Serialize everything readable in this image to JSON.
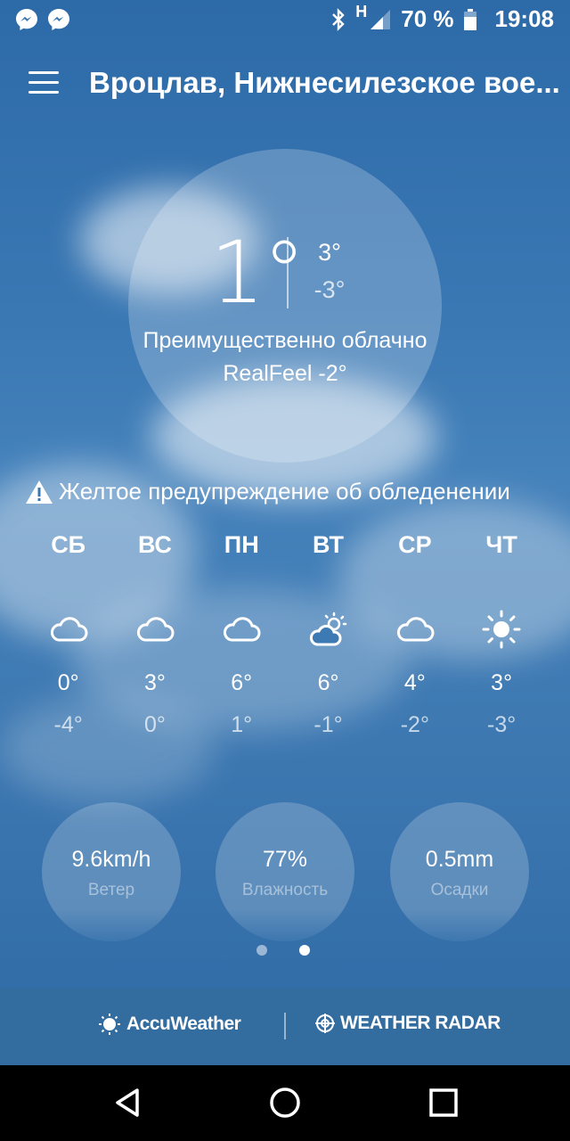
{
  "status_bar": {
    "icons_left": [
      "messenger-icon",
      "messenger-icon"
    ],
    "network": "H",
    "battery": "70 %",
    "time": "19:08"
  },
  "header": {
    "location": "Вроцлав, Нижнесилезское вое..."
  },
  "current": {
    "temp": "1°",
    "high": "3°",
    "low": "-3°",
    "condition": "Преимущественно облачно",
    "realfeel": "RealFeel -2°"
  },
  "alert": {
    "text": "Желтое предупреждение об обледенении"
  },
  "forecast": [
    {
      "day": "СБ",
      "icon": "cloud-icon",
      "high": "0°",
      "low": "-4°"
    },
    {
      "day": "ВС",
      "icon": "cloud-icon",
      "high": "3°",
      "low": "0°"
    },
    {
      "day": "ПН",
      "icon": "cloud-icon",
      "high": "6°",
      "low": "1°"
    },
    {
      "day": "ВТ",
      "icon": "partly-sunny-icon",
      "high": "6°",
      "low": "-1°"
    },
    {
      "day": "СР",
      "icon": "cloud-icon",
      "high": "4°",
      "low": "-2°"
    },
    {
      "day": "ЧТ",
      "icon": "sun-icon",
      "high": "3°",
      "low": "-3°"
    }
  ],
  "metrics": [
    {
      "value": "9.6km/h",
      "label": "Ветер"
    },
    {
      "value": "77%",
      "label": "Влажность"
    },
    {
      "value": "0.5mm",
      "label": "Осадки"
    }
  ],
  "pager": {
    "pages": 2,
    "active": 2
  },
  "footer": {
    "brand": "AccuWeather",
    "radar": "WEATHER RADAR"
  },
  "colors": {
    "background": "#3a78b4",
    "footer": "#336c9f"
  }
}
